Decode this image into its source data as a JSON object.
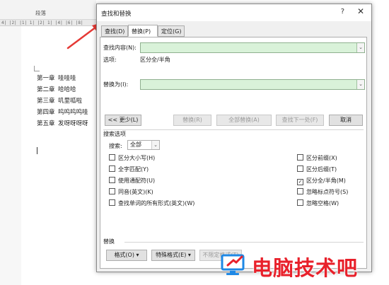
{
  "document": {
    "group_label": "段落",
    "ruler_text": "4| |2| |1| 1| |2| 1| |4| |6| |8|",
    "chapters": [
      {
        "num": "第一章",
        "text": "哇哇哇"
      },
      {
        "num": "第二章",
        "text": "哈哈哈"
      },
      {
        "num": "第三章",
        "text": "叽里呱啦"
      },
      {
        "num": "第四章",
        "text": "呜呜呜呜哇"
      },
      {
        "num": "第五章",
        "text": "发呀呀呀呀"
      }
    ]
  },
  "dialog": {
    "title": "查找和替换",
    "help": "?",
    "close": "✕",
    "tabs": [
      {
        "label": "查找(D)",
        "active": false
      },
      {
        "label": "替换(P)",
        "active": true
      },
      {
        "label": "定位(G)",
        "active": false
      }
    ],
    "find_label": "查找内容(N):",
    "find_value": "",
    "options_label": "选项:",
    "options_value": "区分全/半角",
    "replace_label": "替换为(I):",
    "replace_value": "",
    "buttons": {
      "less": "<< 更少(L)",
      "replace": "替换(R)",
      "replace_all": "全部替换(A)",
      "find_next": "查找下一处(F)",
      "cancel": "取消"
    },
    "search_options_heading": "搜索选项",
    "search_label": "搜索:",
    "search_value": "全部",
    "left_options": [
      {
        "label": "区分大小写(H)",
        "checked": false
      },
      {
        "label": "全字匹配(Y)",
        "checked": false
      },
      {
        "label": "使用通配符(U)",
        "checked": false
      },
      {
        "label": "同音(英文)(K)",
        "checked": false
      },
      {
        "label": "查找单词的所有形式(英文)(W)",
        "checked": false
      }
    ],
    "right_options": [
      {
        "label": "区分前缀(X)",
        "checked": false
      },
      {
        "label": "区分后缀(T)",
        "checked": false
      },
      {
        "label": "区分全/半角(M)",
        "checked": true
      },
      {
        "label": "忽略标点符号(S)",
        "checked": false
      },
      {
        "label": "忽略空格(W)",
        "checked": false
      }
    ],
    "replace_heading": "替换",
    "bottom_buttons": {
      "format": "格式(O) ▾",
      "special": "特殊格式(E) ▾",
      "no_format": "不限定格式(T)"
    }
  },
  "watermark": {
    "text": "电脑技术吧"
  },
  "colors": {
    "combo_bg": "#d9f2d9",
    "arrow": "#e53935",
    "watermark": "#e8212b"
  }
}
